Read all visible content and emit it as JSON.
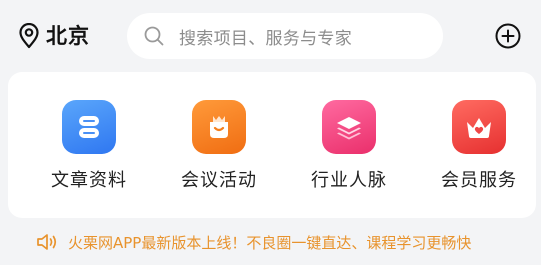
{
  "header": {
    "city": "北京",
    "location_icon": "location-pin-icon",
    "search_placeholder": "搜索项目、服务与专家",
    "search_icon": "search-icon",
    "add_icon": "plus-circle-icon"
  },
  "categories": [
    {
      "label": "文章资料",
      "icon": "document-stack-icon",
      "color": "#3d8af7"
    },
    {
      "label": "会议活动",
      "icon": "gift-box-icon",
      "color": "#f57f1d"
    },
    {
      "label": "行业人脉",
      "icon": "layers-icon",
      "color": "#f0447a"
    },
    {
      "label": "会员服务",
      "icon": "crown-heart-icon",
      "color": "#ef4646"
    }
  ],
  "notice": {
    "icon": "speaker-icon",
    "text": "火栗网APP最新版本上线！不良圈一键直达、课程学习更畅快",
    "color": "#e8932d"
  }
}
